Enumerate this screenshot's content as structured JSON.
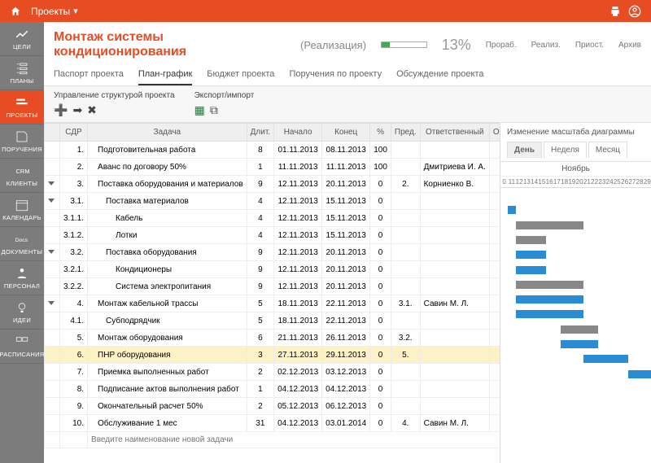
{
  "topbar": {
    "title": "Проекты"
  },
  "sidebar": [
    {
      "id": "goals",
      "label": "ЦЕЛИ"
    },
    {
      "id": "plans",
      "label": "ПЛАНЫ"
    },
    {
      "id": "projects",
      "label": "ПРОЕКТЫ",
      "active": true
    },
    {
      "id": "tasks",
      "label": "ПОРУЧЕНИЯ"
    },
    {
      "id": "crm",
      "label": "КЛИЕНТЫ"
    },
    {
      "id": "calendar",
      "label": "КАЛЕНДАРЬ"
    },
    {
      "id": "docs",
      "label": "ДОКУМЕНТЫ"
    },
    {
      "id": "staff",
      "label": "ПЕРСОНАЛ"
    },
    {
      "id": "ideas",
      "label": "ИДЕИ"
    },
    {
      "id": "sched",
      "label": "РАСПИСАНИЯ"
    }
  ],
  "header": {
    "title": "Монтаж системы кондиционирования",
    "phase": "(Реализация)",
    "percent": "13%",
    "statuses": [
      "Прораб.",
      "Реализ.",
      "Приост.",
      "Архив"
    ]
  },
  "tabs": [
    "Паспорт проекта",
    "План-график",
    "Бюджет проекта",
    "Поручения по проекту",
    "Обсуждение проекта"
  ],
  "active_tab": 1,
  "toolbar": {
    "struct": "Управление структурой проекта",
    "export": "Экспорт/импорт"
  },
  "columns": [
    "",
    "СДР",
    "Задача",
    "Длит.",
    "Начало",
    "Конец",
    "%",
    "Пред.",
    "Ответственный",
    "Отчёт"
  ],
  "rows": [
    {
      "n": "1.",
      "task": "Подготовительная работа",
      "dur": "8",
      "start": "01.11.2013",
      "end": "08.11.2013",
      "pct": "100",
      "pre": "",
      "resp": "",
      "badge": "1",
      "lvl": 2,
      "tri": false
    },
    {
      "n": "2.",
      "task": "Аванс по договору 50%",
      "dur": "1",
      "start": "11.11.2013",
      "end": "11.11.2013",
      "pct": "100",
      "pre": "",
      "resp": "Дмитриева И. А.",
      "badge": "3",
      "lvl": 2,
      "tri": false
    },
    {
      "n": "3.",
      "task": "Поставка оборудования и материалов",
      "dur": "9",
      "start": "12.11.2013",
      "end": "20.11.2013",
      "pct": "0",
      "pre": "2.",
      "resp": "Корниенко В.",
      "badge": "0",
      "lvl": 2,
      "tri": true
    },
    {
      "n": "3.1.",
      "task": "Поставка материалов",
      "dur": "4",
      "start": "12.11.2013",
      "end": "15.11.2013",
      "pct": "0",
      "pre": "",
      "resp": "",
      "badge": "0",
      "lvl": 3,
      "tri": true
    },
    {
      "n": "3.1.1.",
      "task": "Кабель",
      "dur": "4",
      "start": "12.11.2013",
      "end": "15.11.2013",
      "pct": "0",
      "pre": "",
      "resp": "",
      "badge": "0",
      "lvl": 4,
      "tri": false
    },
    {
      "n": "3.1.2.",
      "task": "Лотки",
      "dur": "4",
      "start": "12.11.2013",
      "end": "15.11.2013",
      "pct": "0",
      "pre": "",
      "resp": "",
      "badge": "0",
      "lvl": 4,
      "tri": false
    },
    {
      "n": "3.2.",
      "task": "Поставка оборудования",
      "dur": "9",
      "start": "12.11.2013",
      "end": "20.11.2013",
      "pct": "0",
      "pre": "",
      "resp": "",
      "badge": "0",
      "lvl": 3,
      "tri": true
    },
    {
      "n": "3.2.1.",
      "task": "Кондиционеры",
      "dur": "9",
      "start": "12.11.2013",
      "end": "20.11.2013",
      "pct": "0",
      "pre": "",
      "resp": "",
      "badge": "0",
      "lvl": 4,
      "tri": false
    },
    {
      "n": "3.2.2.",
      "task": "Система электропитания",
      "dur": "9",
      "start": "12.11.2013",
      "end": "20.11.2013",
      "pct": "0",
      "pre": "",
      "resp": "",
      "badge": "0",
      "lvl": 4,
      "tri": false
    },
    {
      "n": "4.",
      "task": "Монтаж кабельной трассы",
      "dur": "5",
      "start": "18.11.2013",
      "end": "22.11.2013",
      "pct": "0",
      "pre": "3.1.",
      "resp": "Савин М. Л.",
      "badge": "0",
      "lvl": 2,
      "tri": true
    },
    {
      "n": "4.1.",
      "task": "Субподрядчик",
      "dur": "5",
      "start": "18.11.2013",
      "end": "22.11.2013",
      "pct": "0",
      "pre": "",
      "resp": "",
      "badge": "0",
      "lvl": 3,
      "tri": false
    },
    {
      "n": "5.",
      "task": "Монтаж оборудования",
      "dur": "6",
      "start": "21.11.2013",
      "end": "26.11.2013",
      "pct": "0",
      "pre": "3.2.",
      "resp": "",
      "badge": "0",
      "lvl": 2,
      "tri": false
    },
    {
      "n": "6.",
      "task": "ПНР оборудования",
      "dur": "3",
      "start": "27.11.2013",
      "end": "29.11.2013",
      "pct": "0",
      "pre": "5.",
      "resp": "",
      "badge": "0",
      "lvl": 2,
      "tri": false,
      "sel": true
    },
    {
      "n": "7.",
      "task": "Приемка выполненных работ",
      "dur": "2",
      "start": "02.12.2013",
      "end": "03.12.2013",
      "pct": "0",
      "pre": "",
      "resp": "",
      "badge": "0",
      "lvl": 2,
      "tri": false
    },
    {
      "n": "8.",
      "task": "Подписание актов выполнения работ",
      "dur": "1",
      "start": "04.12.2013",
      "end": "04.12.2013",
      "pct": "0",
      "pre": "",
      "resp": "",
      "badge": "0",
      "lvl": 2,
      "tri": false
    },
    {
      "n": "9.",
      "task": "Окончательный расчет 50%",
      "dur": "2",
      "start": "05.12.2013",
      "end": "06.12.2013",
      "pct": "0",
      "pre": "",
      "resp": "",
      "badge": "0",
      "lvl": 2,
      "tri": false
    },
    {
      "n": "10.",
      "task": "Обслуживание 1 мес",
      "dur": "31",
      "start": "04.12.2013",
      "end": "03.01.2014",
      "pct": "0",
      "pre": "4.",
      "resp": "Савин М. Л.",
      "badge": "0",
      "lvl": 2,
      "tri": false
    }
  ],
  "new_task_placeholder": "Введите наименование новой задачи",
  "gantt": {
    "title": "Изменение масштаба диаграммы",
    "scales": [
      "День",
      "Неделя",
      "Месяц"
    ],
    "active_scale": 0,
    "month": "Ноябрь",
    "days": [
      "0",
      "11",
      "12",
      "13",
      "14",
      "15",
      "16",
      "17",
      "18",
      "19",
      "20",
      "21",
      "22",
      "23",
      "24",
      "25",
      "26",
      "27",
      "28",
      "29"
    ]
  },
  "chart_data": {
    "type": "gantt",
    "x_domain_days": [
      10,
      29
    ],
    "bars": [
      {
        "row": 2,
        "start": 11,
        "end": 11,
        "color": "blue",
        "kind": "milestone"
      },
      {
        "row": 3,
        "start": 12,
        "end": 20,
        "color": "gray",
        "kind": "summary"
      },
      {
        "row": 4,
        "start": 12,
        "end": 15,
        "color": "gray",
        "kind": "summary"
      },
      {
        "row": 5,
        "start": 12,
        "end": 15,
        "color": "blue",
        "kind": "task"
      },
      {
        "row": 6,
        "start": 12,
        "end": 15,
        "color": "blue",
        "kind": "task"
      },
      {
        "row": 7,
        "start": 12,
        "end": 20,
        "color": "gray",
        "kind": "summary"
      },
      {
        "row": 8,
        "start": 12,
        "end": 20,
        "color": "blue",
        "kind": "task"
      },
      {
        "row": 9,
        "start": 12,
        "end": 20,
        "color": "blue",
        "kind": "task"
      },
      {
        "row": 10,
        "start": 18,
        "end": 22,
        "color": "gray",
        "kind": "summary"
      },
      {
        "row": 11,
        "start": 18,
        "end": 22,
        "color": "blue",
        "kind": "task"
      },
      {
        "row": 12,
        "start": 21,
        "end": 26,
        "color": "blue",
        "kind": "task"
      },
      {
        "row": 13,
        "start": 27,
        "end": 29,
        "color": "blue",
        "kind": "task"
      }
    ]
  }
}
